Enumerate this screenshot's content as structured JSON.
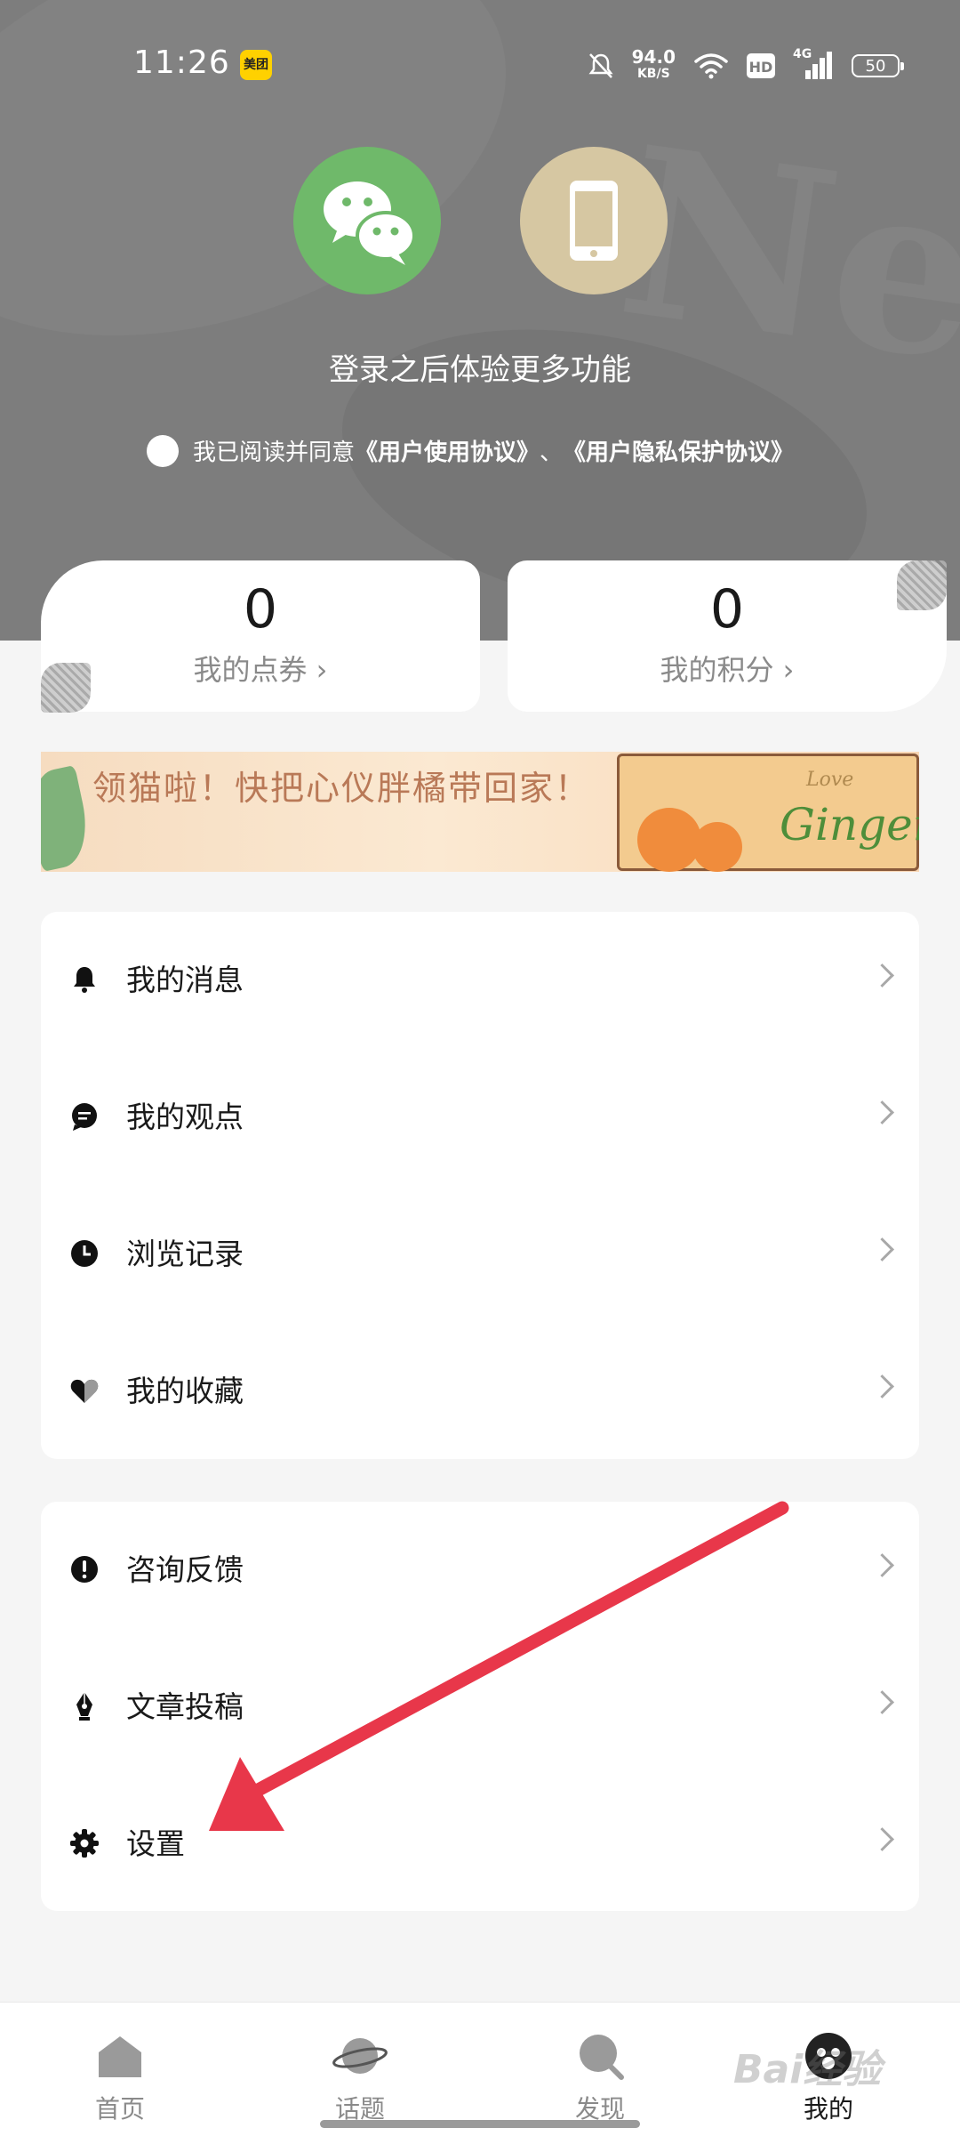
{
  "status_bar": {
    "time": "11:26",
    "app_badge": "美团",
    "net_speed": "94.0",
    "net_speed_unit": "KB/S",
    "hd_label": "HD",
    "network_label": "4G",
    "battery": "50"
  },
  "login": {
    "prompt": "登录之后体验更多功能",
    "agree_prefix": "我已阅读并同意",
    "user_agreement": "《用户使用协议》",
    "separator": "、",
    "privacy_agreement": "《用户隐私保护协议》",
    "methods": [
      "wechat-icon",
      "phone-icon"
    ]
  },
  "stats": [
    {
      "value": "0",
      "label": "我的点券 ›"
    },
    {
      "value": "0",
      "label": "我的积分 ›"
    }
  ],
  "banner": {
    "text": "领猫啦！快把心仪胖橘带回家！",
    "brand": "Ginger",
    "brand_small": "Love"
  },
  "menu_group_1": [
    {
      "icon": "bell-icon",
      "label": "我的消息"
    },
    {
      "icon": "comment-icon",
      "label": "我的观点"
    },
    {
      "icon": "clock-icon",
      "label": "浏览记录"
    },
    {
      "icon": "heart-icon",
      "label": "我的收藏"
    }
  ],
  "menu_group_2": [
    {
      "icon": "exclamation-icon",
      "label": "咨询反馈"
    },
    {
      "icon": "pen-nib-icon",
      "label": "文章投稿"
    },
    {
      "icon": "gear-icon",
      "label": "设置"
    }
  ],
  "tabs": [
    {
      "icon": "home-icon",
      "label": "首页"
    },
    {
      "icon": "planet-icon",
      "label": "话题"
    },
    {
      "icon": "search-icon",
      "label": "发现"
    },
    {
      "icon": "avatar-icon",
      "label": "我的"
    }
  ],
  "colors": {
    "header_bg": "#7d7d7d",
    "wechat": "#6fb96a",
    "phone": "#d6c7a2",
    "annotation_arrow": "#e8374a"
  },
  "watermark": "Bai经验"
}
